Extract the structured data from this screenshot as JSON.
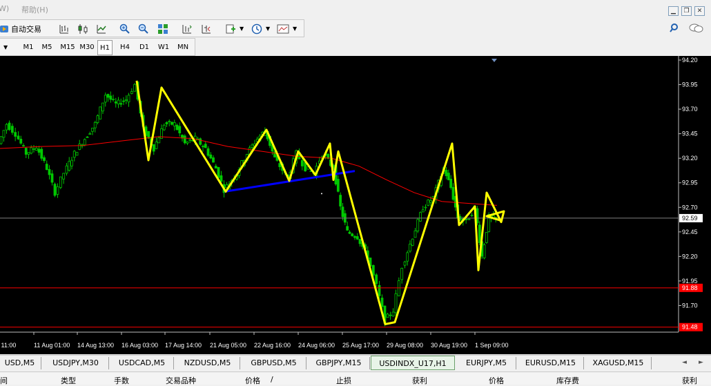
{
  "menubar": {
    "left_fragment": "W)",
    "help": "帮助(H)"
  },
  "toolbar": {
    "auto_trade": "自动交易"
  },
  "timeframes": [
    {
      "label": "M1",
      "active": false
    },
    {
      "label": "M5",
      "active": false
    },
    {
      "label": "M15",
      "active": false
    },
    {
      "label": "M30",
      "active": false
    },
    {
      "label": "H1",
      "active": true
    },
    {
      "label": "H4",
      "active": false
    },
    {
      "label": "D1",
      "active": false
    },
    {
      "label": "W1",
      "active": false
    },
    {
      "label": "MN",
      "active": false
    }
  ],
  "tabs": [
    {
      "label": "USD,M5"
    },
    {
      "label": "USDJPY,M30"
    },
    {
      "label": "USDCAD,M5"
    },
    {
      "label": "NZDUSD,M5"
    },
    {
      "label": "GBPUSD,M5"
    },
    {
      "label": "GBPJPY,M15"
    },
    {
      "label": "USDINDX_U17,H1",
      "active": true
    },
    {
      "label": "EURJPY,M5"
    },
    {
      "label": "EURUSD,M15"
    },
    {
      "label": "XAGUSD,M15"
    }
  ],
  "columns": [
    "间",
    "类型",
    "手数",
    "交易品种",
    "价格",
    "/",
    "止损",
    "获利",
    "价格",
    "库存费",
    "获利"
  ],
  "colors": {
    "background": "#000000",
    "candles": "#00c800",
    "moving_average": "#ff0000",
    "zigzag": "#ffff00",
    "trendline": "#0000ff",
    "current_price_line": "#808080",
    "level_line": "#ff0000"
  },
  "chart_data": {
    "type": "candlestick",
    "symbol": "USDINDX_U17",
    "timeframe": "H1",
    "y_ticks": [
      "94.20",
      "93.95",
      "93.70",
      "93.45",
      "93.20",
      "92.95",
      "92.70",
      "92.45",
      "92.20",
      "91.95",
      "91.70"
    ],
    "ylim": [
      91.45,
      94.2
    ],
    "x_ticks": [
      "g 11:00",
      "11 Aug 01:00",
      "14 Aug 13:00",
      "16 Aug 03:00",
      "17 Aug 14:00",
      "21 Aug 05:00",
      "22 Aug 16:00",
      "24 Aug 06:00",
      "25 Aug 17:00",
      "29 Aug 08:00",
      "30 Aug 19:00",
      "1 Sep 09:00"
    ],
    "current_price": "92.59",
    "level_lines": [
      {
        "label": "91.88",
        "value": 91.88
      },
      {
        "label": "91.48",
        "value": 91.48
      }
    ],
    "zigzag_points": [
      [
        198,
        93.99
      ],
      [
        215,
        93.18
      ],
      [
        234,
        93.92
      ],
      [
        327,
        92.86
      ],
      [
        386,
        93.49
      ],
      [
        419,
        92.97
      ],
      [
        432,
        93.27
      ],
      [
        457,
        93.03
      ],
      [
        478,
        93.35
      ],
      [
        483,
        92.98
      ],
      [
        490,
        93.27
      ],
      [
        558,
        91.51
      ],
      [
        572,
        91.53
      ],
      [
        655,
        93.35
      ],
      [
        665,
        92.52
      ],
      [
        688,
        92.71
      ],
      [
        693,
        92.06
      ],
      [
        705,
        92.85
      ],
      [
        726,
        92.55
      ],
      [
        730,
        92.66
      ],
      [
        705,
        92.61
      ],
      [
        728,
        92.56
      ]
    ],
    "trendline": [
      [
        325,
        92.86
      ],
      [
        514,
        93.07
      ]
    ],
    "moving_average": [
      [
        0,
        93.3
      ],
      [
        60,
        93.32
      ],
      [
        120,
        93.33
      ],
      [
        180,
        93.38
      ],
      [
        230,
        93.42
      ],
      [
        280,
        93.4
      ],
      [
        330,
        93.32
      ],
      [
        380,
        93.27
      ],
      [
        430,
        93.22
      ],
      [
        480,
        93.2
      ],
      [
        520,
        93.12
      ],
      [
        560,
        92.98
      ],
      [
        600,
        92.85
      ],
      [
        640,
        92.76
      ],
      [
        680,
        92.74
      ],
      [
        720,
        92.72
      ]
    ],
    "candle_path": [
      [
        0,
        93.35
      ],
      [
        12,
        93.55
      ],
      [
        25,
        93.45
      ],
      [
        40,
        93.25
      ],
      [
        55,
        93.32
      ],
      [
        70,
        93.1
      ],
      [
        82,
        92.85
      ],
      [
        95,
        93.05
      ],
      [
        110,
        93.25
      ],
      [
        125,
        93.4
      ],
      [
        140,
        93.55
      ],
      [
        155,
        93.85
      ],
      [
        170,
        93.75
      ],
      [
        185,
        93.8
      ],
      [
        198,
        93.95
      ],
      [
        210,
        93.5
      ],
      [
        225,
        93.3
      ],
      [
        240,
        93.55
      ],
      [
        255,
        93.55
      ],
      [
        270,
        93.35
      ],
      [
        285,
        93.4
      ],
      [
        300,
        93.3
      ],
      [
        315,
        93.1
      ],
      [
        327,
        92.88
      ],
      [
        345,
        93.05
      ],
      [
        360,
        93.25
      ],
      [
        375,
        93.4
      ],
      [
        386,
        93.48
      ],
      [
        400,
        93.2
      ],
      [
        419,
        93.0
      ],
      [
        432,
        93.25
      ],
      [
        445,
        93.1
      ],
      [
        457,
        93.05
      ],
      [
        470,
        93.25
      ],
      [
        485,
        93.1
      ],
      [
        495,
        92.7
      ],
      [
        505,
        92.45
      ],
      [
        520,
        92.4
      ],
      [
        535,
        92.2
      ],
      [
        548,
        91.9
      ],
      [
        560,
        91.55
      ],
      [
        572,
        91.65
      ],
      [
        585,
        92.1
      ],
      [
        600,
        92.4
      ],
      [
        615,
        92.7
      ],
      [
        630,
        92.8
      ],
      [
        645,
        93.1
      ],
      [
        655,
        92.9
      ],
      [
        665,
        92.6
      ],
      [
        678,
        92.55
      ],
      [
        690,
        92.7
      ],
      [
        700,
        92.2
      ],
      [
        710,
        92.6
      ],
      [
        720,
        92.58
      ]
    ]
  }
}
